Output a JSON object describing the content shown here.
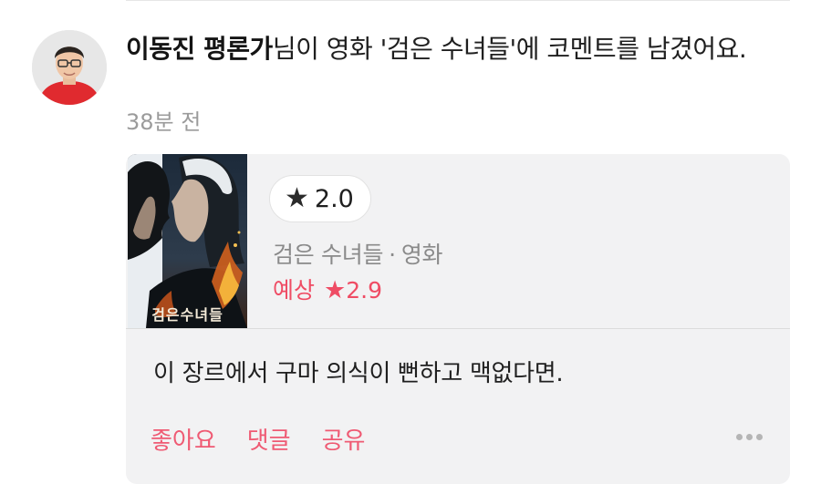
{
  "activity": {
    "author": "이동진 평론가",
    "message": "님이 영화 '검은 수녀들'에 코멘트를 남겼어요.",
    "timestamp": "38분 전"
  },
  "movie": {
    "poster_title": "검은수녀들",
    "title": "검은 수녀들",
    "separator": "·",
    "category": "영화",
    "my_rating": "2.0",
    "predicted_label": "예상",
    "predicted_rating": "2.9",
    "star_icon": "star-icon"
  },
  "comment": {
    "text": "이 장르에서 구마 의식이 뻔하고 맥없다면."
  },
  "actions": {
    "like": "좋아요",
    "reply": "댓글",
    "share": "공유"
  },
  "colors": {
    "accent": "#ef5a73",
    "muted": "#9b9b9b",
    "card_bg": "#f2f2f3"
  }
}
